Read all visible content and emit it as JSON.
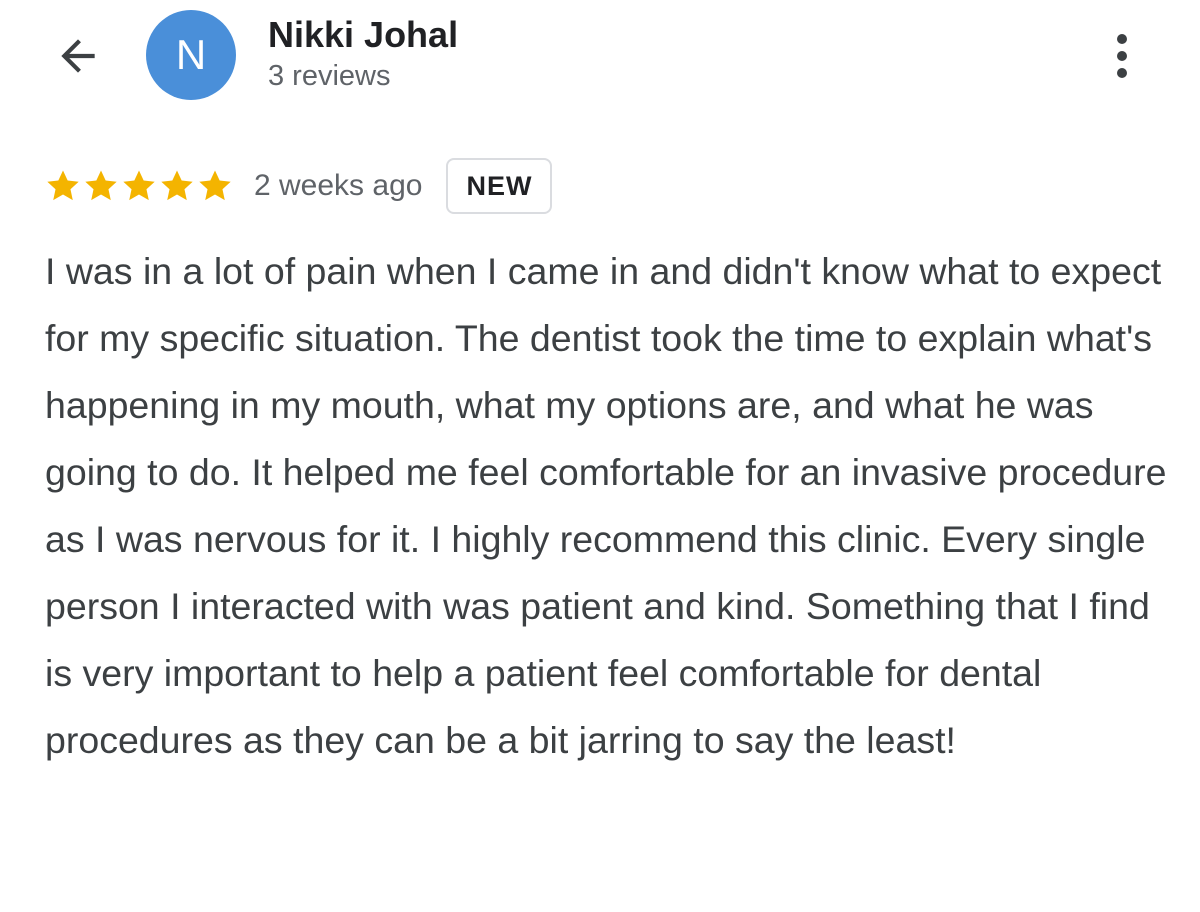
{
  "header": {
    "back_icon": "arrow-back-icon",
    "avatar_initial": "N",
    "avatar_color": "#4a8fd9",
    "reviewer_name": "Nikki Johal",
    "review_count": "3 reviews",
    "more_icon": "more-vertical-icon"
  },
  "review": {
    "rating": 5,
    "max_rating": 5,
    "star_color": "#f4b400",
    "date": "2 weeks ago",
    "badge": "NEW",
    "text": "I was in a lot of pain when I came in and didn't know what to expect for my specific situation. The dentist took the time to explain what's happening in my mouth, what my options are, and what he was going to do. It helped me feel comfortable for an invasive procedure as I was nervous for it. I highly recommend this clinic. Every single person I interacted with was patient and kind. Something that I find is very important to help a patient feel comfortable for dental procedures as they can be a bit jarring to say the least!"
  }
}
